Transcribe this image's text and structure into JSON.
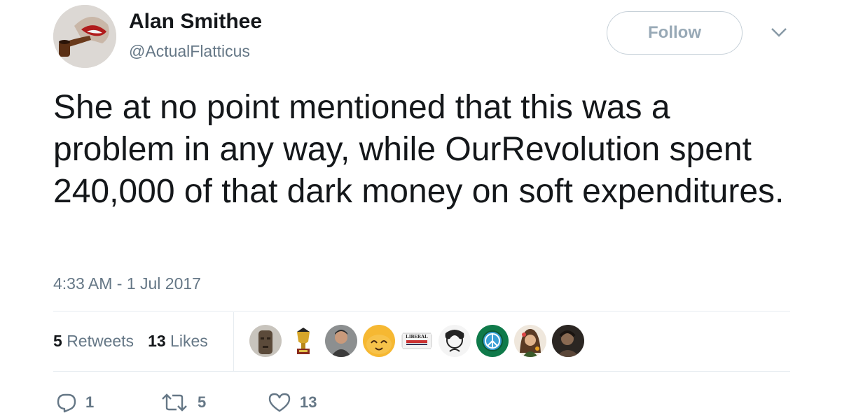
{
  "author": {
    "name": "Alan Smithee",
    "handle": "@ActualFlatticus"
  },
  "follow_label": "Follow",
  "tweet": {
    "text": "She at no point mentioned that this was a problem in any way, while OurRevolution spent 240,000 of that dark money on soft expenditures.",
    "timestamp": "4:33 AM - 1 Jul 2017"
  },
  "stats": {
    "retweets_count": "5",
    "retweets_label": "Retweets",
    "likes_count": "13",
    "likes_label": "Likes"
  },
  "likers": [
    {
      "icon": "liker-avatar-moai"
    },
    {
      "icon": "liker-avatar-trophy"
    },
    {
      "icon": "liker-avatar-man"
    },
    {
      "icon": "liker-avatar-cat"
    },
    {
      "icon": "liker-avatar-liberal-conservative",
      "text": "LIBERAL"
    },
    {
      "icon": "liker-avatar-sketch"
    },
    {
      "icon": "liker-avatar-peace"
    },
    {
      "icon": "liker-avatar-woman"
    },
    {
      "icon": "liker-avatar-dark"
    }
  ],
  "actions": {
    "reply_count": "1",
    "retweet_count": "5",
    "like_count": "13"
  },
  "colors": {
    "text": "#14171a",
    "secondary": "#657786",
    "border": "#e6ecf0",
    "follow_text": "#98a9b6"
  }
}
